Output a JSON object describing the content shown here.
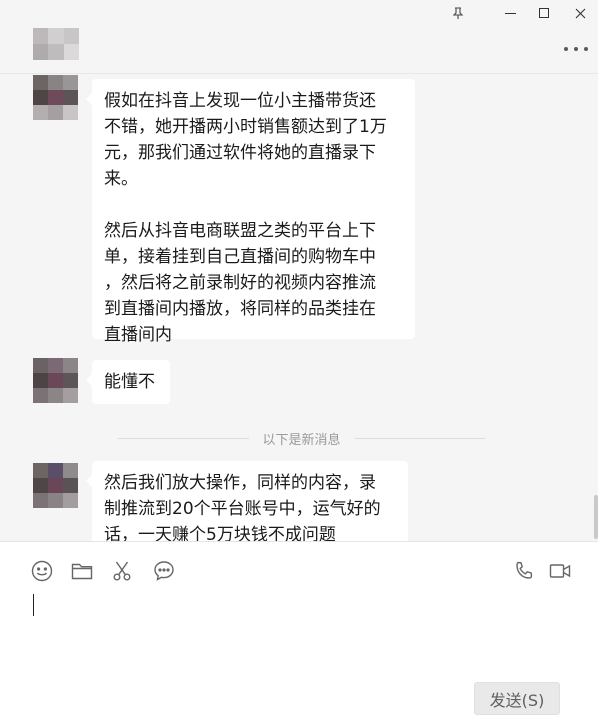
{
  "window": {
    "controls": [
      "pin-icon",
      "minimize-icon",
      "maximize-icon",
      "close-icon"
    ]
  },
  "messages": [
    {
      "text": "假如在抖音上发现一位小主播带货还\n不错，她开播两小时销售额达到了1万\n元，那我们通过软件将她的直播录下\n来。\n\n然后从抖音电商联盟之类的平台上下\n单，接着挂到自己直播间的购物车中\n，然后将之前录制好的视频内容推流\n到直播间内播放，将同样的品类挂在\n直播间内"
    },
    {
      "text": "能懂不"
    },
    {
      "text": "然后我们放大操作，同样的内容，录\n制推流到20个平台账号中，运气好的\n话，一天赚个5万块钱不成问题"
    }
  ],
  "divider_text": "以下是新消息",
  "toolbar": {
    "left_icons": [
      "emoji-icon",
      "folder-icon",
      "scissors-icon",
      "chat-history-icon"
    ],
    "right_icons": [
      "phone-icon",
      "video-call-icon"
    ]
  },
  "send_label": "发送(S)",
  "colors": {
    "background": "#f5f5f5",
    "bubble": "#ffffff",
    "input_area": "#ffffff",
    "send_button": "#e9e9e9"
  }
}
